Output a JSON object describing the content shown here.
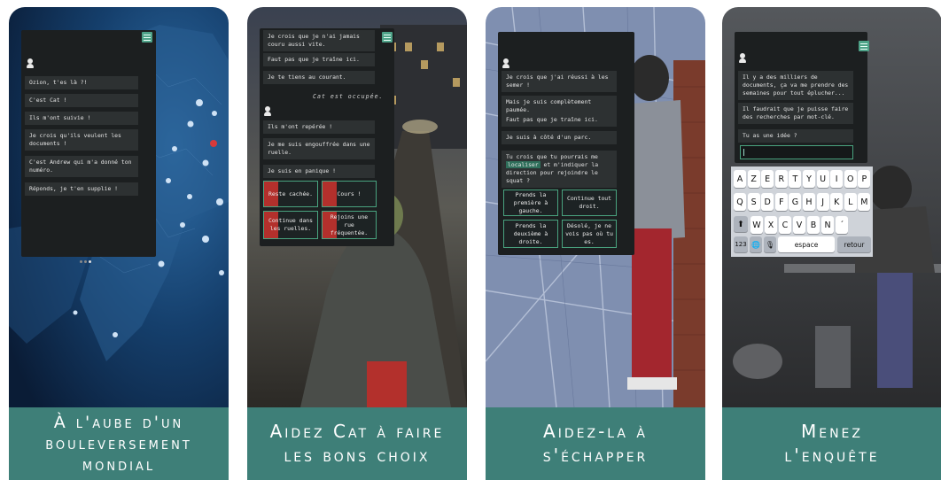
{
  "cards": [
    {
      "caption": [
        "À l'aube d'un",
        "bouleversement",
        "mondial"
      ],
      "messages": [
        "Ozion, t'es là ?!",
        "C'est Cat !",
        "Ils m'ont suivie !",
        "Je crois qu'ils veulent les documents !",
        "C'est Andrew qui m'a donné ton numéro.",
        "Réponds, je t'en supplie !"
      ]
    },
    {
      "caption": [
        "Aidez Cat à faire",
        "les bons choix"
      ],
      "messages_top": [
        "Je crois que je n'ai jamais couru aussi vite.",
        "Faut pas que je traîne ici.",
        "Je te tiens au courant."
      ],
      "status": "Cat est occupée.",
      "messages_bottom": [
        "Ils m'ont repérée !",
        "Je me suis engouffrée dans une ruelle.",
        "Je suis en panique !"
      ],
      "choices": [
        "Reste cachée.",
        "Cours !",
        "Continue dans les ruelles.",
        "Rejoins une rue fréquentée."
      ]
    },
    {
      "caption": [
        "Aidez-la à",
        "s'échapper"
      ],
      "messages": [
        "Je crois que j'ai réussi à les semer !",
        "Mais je suis complètement paumée.",
        "Faut pas que je traîne ici.",
        "Je suis à côté d'un parc."
      ],
      "request_pre": "Tu crois que tu pourrais me",
      "request_highlight": "localiser",
      "request_post": "et m'indiquer la direction pour rejoindre le squat ?",
      "choices": [
        "Prends la première à gauche.",
        "Continue tout droit.",
        "Prends la deuxième à droite.",
        "Désolé, je ne vois pas où tu es."
      ]
    },
    {
      "caption": [
        "Menez",
        "l'enquête"
      ],
      "messages": [
        "Il y a des milliers de documents, ça va me prendre des semaines pour tout éplucher...",
        "Il faudrait que je puisse faire des recherches par mot-clé.",
        "Tu as une idée ?"
      ],
      "keyboard": {
        "row1": [
          "A",
          "Z",
          "E",
          "R",
          "T",
          "Y",
          "U",
          "I",
          "O",
          "P"
        ],
        "row2": [
          "Q",
          "S",
          "D",
          "F",
          "G",
          "H",
          "J",
          "K",
          "L",
          "M"
        ],
        "row3": [
          "W",
          "X",
          "C",
          "V",
          "B",
          "N",
          "´"
        ],
        "shift": "⬆",
        "numbers": "123",
        "globe": "🌐",
        "mic": "🎙",
        "space": "espace",
        "return": "retour"
      }
    }
  ],
  "colors": {
    "caption_bg": "#3e7f78",
    "accent": "#49a37f",
    "alert": "#b3302c"
  }
}
